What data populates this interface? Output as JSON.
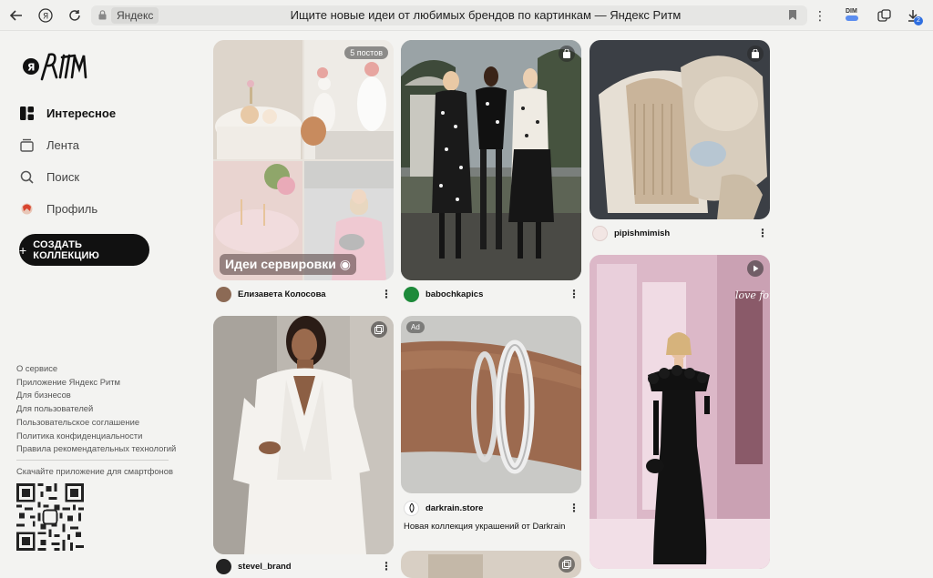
{
  "browser": {
    "domain": "Яндекс",
    "page_title": "Ищите новые идеи от любимых брендов по картинкам — Яндекс Ритм",
    "dim_label": "DIM",
    "downloads_count": "2"
  },
  "sidebar": {
    "logo_text": "Я РИТМ",
    "nav": [
      {
        "label": "Интересное",
        "icon": "grid-icon",
        "active": true
      },
      {
        "label": "Лента",
        "icon": "feed-icon"
      },
      {
        "label": "Поиск",
        "icon": "search-icon"
      },
      {
        "label": "Профиль",
        "icon": "profile-icon"
      }
    ],
    "create_button": "СОЗДАТЬ КОЛЛЕКЦИЮ",
    "footer_links": [
      "О сервисе",
      "Приложение Яндекс Ритм",
      "Для бизнесов",
      "Для пользователей",
      "Пользовательское соглашение",
      "Политика конфиденциальности",
      "Правила рекомендательных технологий"
    ],
    "app_download_text": "Скачайте приложение для смартфонов"
  },
  "feed": {
    "cards": [
      {
        "id": "serving",
        "badge": "5 постов",
        "overlay_label": "Идеи сервировки",
        "author": "Елизавета Колосова"
      },
      {
        "id": "dots",
        "author": "babochkapics"
      },
      {
        "id": "knit",
        "author": "pipishmimish"
      },
      {
        "id": "suit",
        "author": "stevel_brand"
      },
      {
        "id": "bracelet",
        "badge": "Ad",
        "author": "darkrain.store",
        "caption": "Новая коллекция украшений от Darkrain"
      },
      {
        "id": "gown",
        "watermark": "love forever"
      }
    ]
  }
}
